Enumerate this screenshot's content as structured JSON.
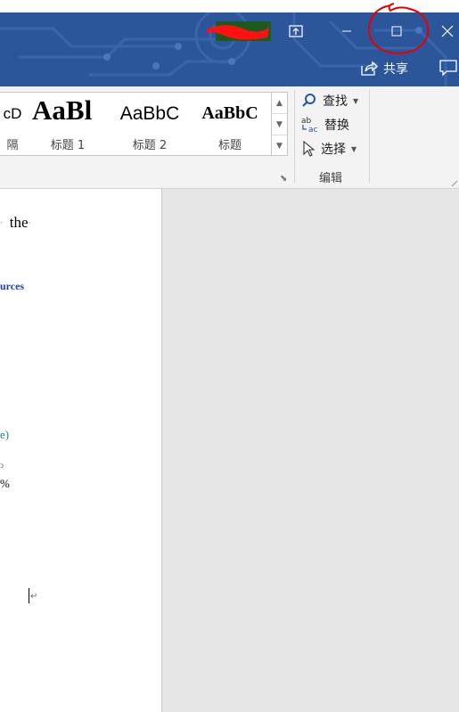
{
  "titlebar": {
    "share_label": "共享",
    "colors": {
      "bar": "#2b579a",
      "annotation": "#e60000"
    },
    "icons": [
      "ribbon-display-options-icon",
      "minimize-icon",
      "maximize-icon",
      "close-icon",
      "share-icon",
      "comment-icon"
    ]
  },
  "ribbon": {
    "styles": [
      {
        "preview": "cD",
        "name": "隔"
      },
      {
        "preview": "AaBl",
        "name": "标题 1"
      },
      {
        "preview": "AaBbC",
        "name": "标题 2"
      },
      {
        "preview": "AaBbC",
        "name": "标题"
      }
    ],
    "editing": {
      "find": "查找",
      "replace": "替换",
      "select": "选择",
      "group_label": "编辑"
    }
  },
  "document": {
    "line1": "the",
    "line2": "urces",
    "line3": "e)",
    "line4": "%"
  }
}
